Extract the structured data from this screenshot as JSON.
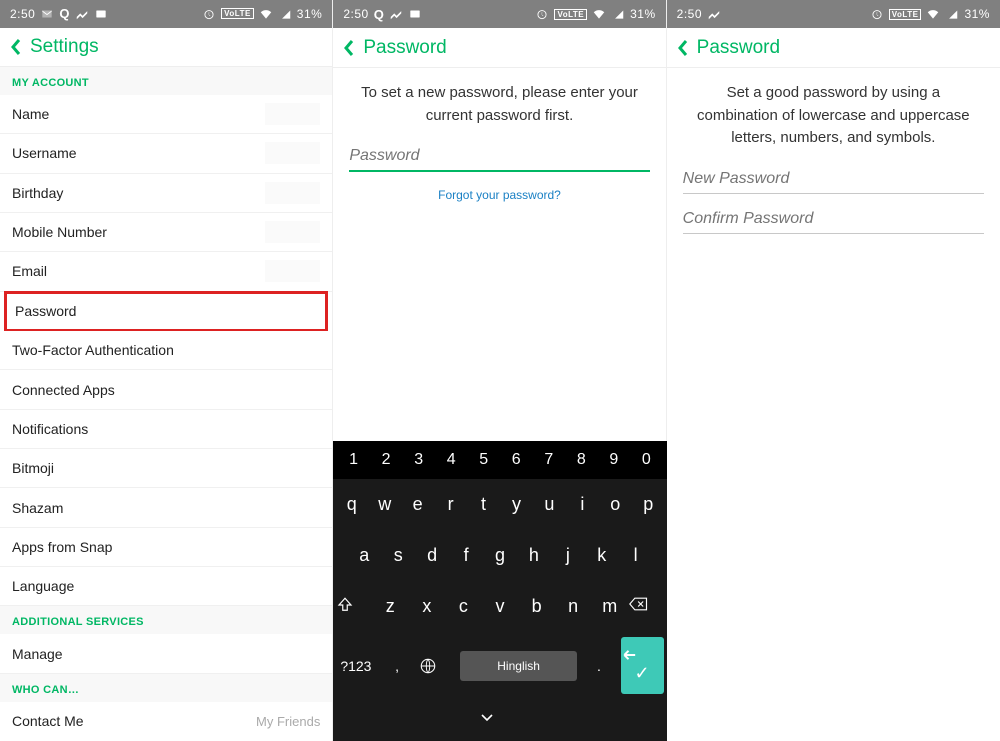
{
  "status": {
    "time": "2:50",
    "battery": "31%",
    "volte": "VoLTE"
  },
  "screen1": {
    "title": "Settings",
    "sections": {
      "acct": "MY ACCOUNT",
      "addl": "ADDITIONAL SERVICES",
      "who": "WHO CAN…"
    },
    "rows": {
      "name": "Name",
      "username": "Username",
      "birthday": "Birthday",
      "mobile": "Mobile Number",
      "email": "Email",
      "password": "Password",
      "twofa": "Two-Factor Authentication",
      "apps": "Connected Apps",
      "notif": "Notifications",
      "bitmoji": "Bitmoji",
      "shazam": "Shazam",
      "afs": "Apps from Snap",
      "lang": "Language",
      "manage": "Manage",
      "contact": "Contact Me",
      "contact_val": "My Friends"
    }
  },
  "screen2": {
    "title": "Password",
    "inst": "To set a new password, please enter your current password first.",
    "ph": "Password",
    "forgot": "Forgot your password?",
    "keys": {
      "nums": [
        "1",
        "2",
        "3",
        "4",
        "5",
        "6",
        "7",
        "8",
        "9",
        "0"
      ],
      "r1": [
        "q",
        "w",
        "e",
        "r",
        "t",
        "y",
        "u",
        "i",
        "o",
        "p"
      ],
      "r2": [
        "a",
        "s",
        "d",
        "f",
        "g",
        "h",
        "j",
        "k",
        "l"
      ],
      "r3": [
        "z",
        "x",
        "c",
        "v",
        "b",
        "n",
        "m"
      ],
      "sym": "?123",
      "space": "Hinglish"
    }
  },
  "screen3": {
    "title": "Password",
    "inst": "Set a good password by using a combination of lowercase and uppercase letters, numbers, and symbols.",
    "ph1": "New Password",
    "ph2": "Confirm Password"
  }
}
